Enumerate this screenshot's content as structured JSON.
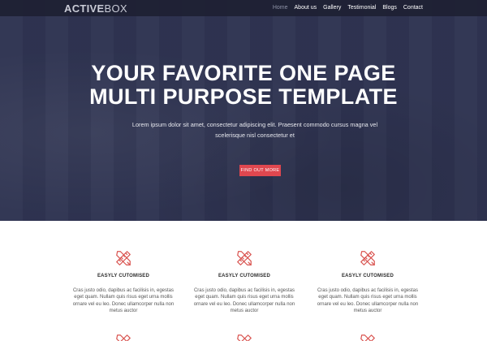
{
  "colors": {
    "hero_bg": "#2f3452",
    "nav_bg": "#1c1e30",
    "accent": "#e0474f",
    "icon": "#d9534f"
  },
  "logo": {
    "part1": "ACTIVE",
    "part2": "BOX"
  },
  "nav": {
    "items": [
      {
        "label": "Home",
        "active": true
      },
      {
        "label": "About us",
        "active": false
      },
      {
        "label": "Gallery",
        "active": false
      },
      {
        "label": "Testimonial",
        "active": false
      },
      {
        "label": "Blogs",
        "active": false
      },
      {
        "label": "Contact",
        "active": false
      }
    ]
  },
  "hero": {
    "title_line1": "YOUR FAVORITE ONE PAGE",
    "title_line2": "MULTI PURPOSE TEMPLATE",
    "subtitle": "Lorem ipsum dolor sit amet, consectetur adipiscing elit. Praesent commodo cursus magna vel scelerisque nisl consectetur et",
    "button_label": "FIND OUT MORE"
  },
  "features": {
    "icon_name": "pencil-ruler-icon",
    "items": [
      {
        "title": "EASYLY CUTOMISED",
        "text": "Cras justo odio, dapibus ac facilisis in, egestas eget quam. Nullam quis risus eget urna mollis ornare vel eu leo. Donec ullamcorper nulla non metus auctor"
      },
      {
        "title": "EASYLY CUTOMISED",
        "text": "Cras justo odio, dapibus ac facilisis in, egestas eget quam. Nullam quis risus eget urna mollis ornare vel eu leo. Donec ullamcorper nulla non metus auctor"
      },
      {
        "title": "EASYLY CUTOMISED",
        "text": "Cras justo odio, dapibus ac facilisis in, egestas eget quam. Nullam quis risus eget urna mollis ornare vel eu leo. Donec ullamcorper nulla non metus auctor"
      }
    ]
  }
}
